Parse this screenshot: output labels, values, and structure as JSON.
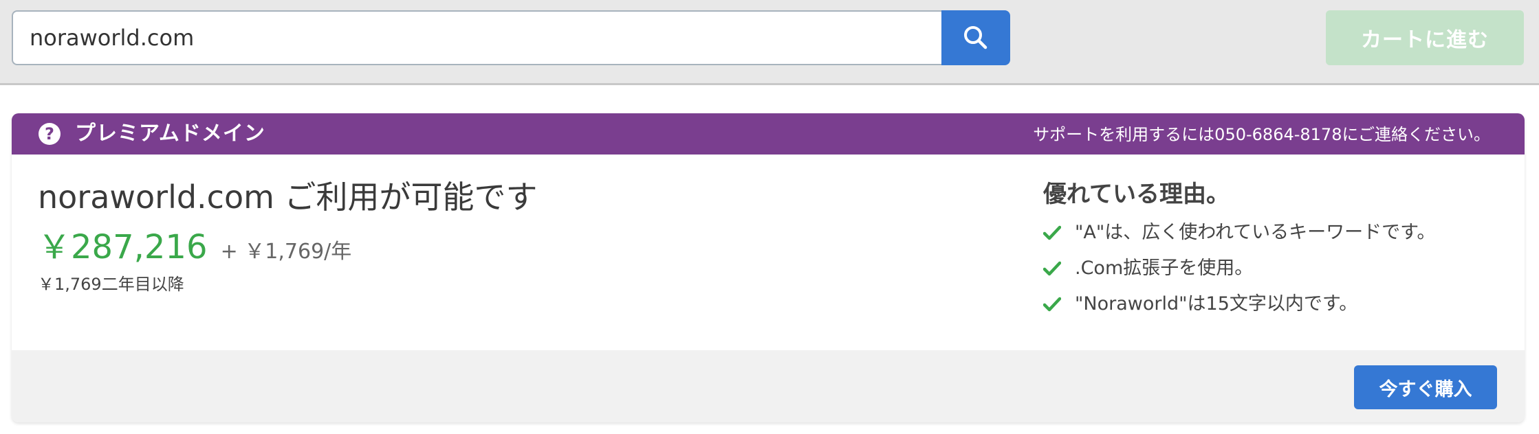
{
  "search": {
    "value": "noraworld.com",
    "icon": "search-icon",
    "cart_label": "カートに進む"
  },
  "card": {
    "header_title": "プレミアムドメイン",
    "help_icon": "?",
    "support_text": "サポートを利用するには050-6864-8178にご連絡ください。",
    "availability": "noraworld.com ご利用が可能です",
    "price_main": "￥287,216",
    "price_renew": "+ ￥1,769/年",
    "price_note": "￥1,769二年目以降",
    "reasons_title": "優れている理由。",
    "reasons": [
      "\"A\"は、広く使われているキーワードです。",
      ".Com拡張子を使用。",
      "\"Noraworld\"は15文字以内です。"
    ],
    "buy_label": "今すぐ購入"
  },
  "colors": {
    "header_purple": "#7a3e8f",
    "primary_blue": "#3578d4",
    "price_green": "#3aa84a",
    "cart_disabled_green": "#c4e2c9"
  }
}
